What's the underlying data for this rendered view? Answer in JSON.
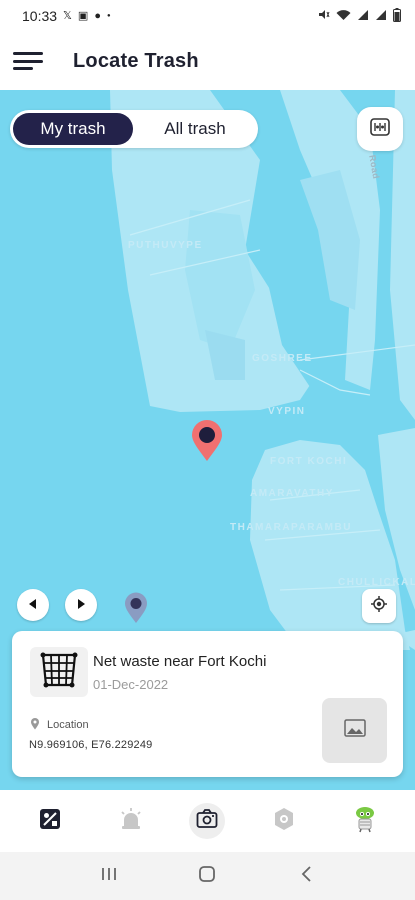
{
  "status_bar": {
    "time": "10:33",
    "left_icons": [
      "x-icon",
      "image-icon",
      "account-icon",
      "dot-icon"
    ],
    "right_icons": [
      "mute-icon",
      "wifi-icon",
      "signal-icon",
      "signal-icon",
      "battery-icon"
    ]
  },
  "header": {
    "title": "Locate Trash",
    "menu_icon": "hamburger-menu-icon"
  },
  "map": {
    "toggle": {
      "my_trash_label": "My trash",
      "all_trash_label": "All trash",
      "selected": "My trash"
    },
    "labels": {
      "puthuvype": "PUTHUVYPE",
      "goshree": "GOSHREE",
      "vypin": "VYPIN",
      "fort_kochi": "FORT KOCHI",
      "amaravathy": "AMARAVATHY",
      "thamaraparambu": "THAMARAPARAMBU",
      "chullickal": "CHULLICKAL",
      "road_label": "Road"
    },
    "colors": {
      "water": "#76d6ef",
      "land": "#aee6f5",
      "marker_active": "#f07070",
      "marker_inactive": "#8a9cc2"
    }
  },
  "card": {
    "title": "Net waste near Fort Kochi",
    "date": "01-Dec-2022",
    "location_label": "Location",
    "coordinates": "N9.969106, E76.229249"
  },
  "bottom_nav": {
    "items": [
      "map-trash-icon",
      "alert-icon",
      "camera-icon",
      "badge-icon",
      "mascot-icon"
    ]
  },
  "android_nav": [
    "recents-icon",
    "home-icon",
    "back-icon"
  ]
}
